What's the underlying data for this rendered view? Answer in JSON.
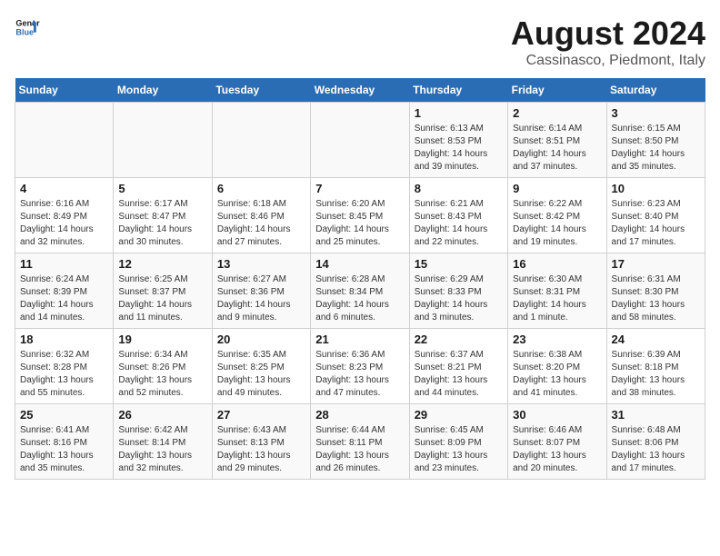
{
  "logo": {
    "line1": "General",
    "line2": "Blue"
  },
  "title": "August 2024",
  "subtitle": "Cassinasco, Piedmont, Italy",
  "days_header": [
    "Sunday",
    "Monday",
    "Tuesday",
    "Wednesday",
    "Thursday",
    "Friday",
    "Saturday"
  ],
  "weeks": [
    [
      {
        "day": "",
        "info": ""
      },
      {
        "day": "",
        "info": ""
      },
      {
        "day": "",
        "info": ""
      },
      {
        "day": "",
        "info": ""
      },
      {
        "day": "1",
        "info": "Sunrise: 6:13 AM\nSunset: 8:53 PM\nDaylight: 14 hours and 39 minutes."
      },
      {
        "day": "2",
        "info": "Sunrise: 6:14 AM\nSunset: 8:51 PM\nDaylight: 14 hours and 37 minutes."
      },
      {
        "day": "3",
        "info": "Sunrise: 6:15 AM\nSunset: 8:50 PM\nDaylight: 14 hours and 35 minutes."
      }
    ],
    [
      {
        "day": "4",
        "info": "Sunrise: 6:16 AM\nSunset: 8:49 PM\nDaylight: 14 hours and 32 minutes."
      },
      {
        "day": "5",
        "info": "Sunrise: 6:17 AM\nSunset: 8:47 PM\nDaylight: 14 hours and 30 minutes."
      },
      {
        "day": "6",
        "info": "Sunrise: 6:18 AM\nSunset: 8:46 PM\nDaylight: 14 hours and 27 minutes."
      },
      {
        "day": "7",
        "info": "Sunrise: 6:20 AM\nSunset: 8:45 PM\nDaylight: 14 hours and 25 minutes."
      },
      {
        "day": "8",
        "info": "Sunrise: 6:21 AM\nSunset: 8:43 PM\nDaylight: 14 hours and 22 minutes."
      },
      {
        "day": "9",
        "info": "Sunrise: 6:22 AM\nSunset: 8:42 PM\nDaylight: 14 hours and 19 minutes."
      },
      {
        "day": "10",
        "info": "Sunrise: 6:23 AM\nSunset: 8:40 PM\nDaylight: 14 hours and 17 minutes."
      }
    ],
    [
      {
        "day": "11",
        "info": "Sunrise: 6:24 AM\nSunset: 8:39 PM\nDaylight: 14 hours and 14 minutes."
      },
      {
        "day": "12",
        "info": "Sunrise: 6:25 AM\nSunset: 8:37 PM\nDaylight: 14 hours and 11 minutes."
      },
      {
        "day": "13",
        "info": "Sunrise: 6:27 AM\nSunset: 8:36 PM\nDaylight: 14 hours and 9 minutes."
      },
      {
        "day": "14",
        "info": "Sunrise: 6:28 AM\nSunset: 8:34 PM\nDaylight: 14 hours and 6 minutes."
      },
      {
        "day": "15",
        "info": "Sunrise: 6:29 AM\nSunset: 8:33 PM\nDaylight: 14 hours and 3 minutes."
      },
      {
        "day": "16",
        "info": "Sunrise: 6:30 AM\nSunset: 8:31 PM\nDaylight: 14 hours and 1 minute."
      },
      {
        "day": "17",
        "info": "Sunrise: 6:31 AM\nSunset: 8:30 PM\nDaylight: 13 hours and 58 minutes."
      }
    ],
    [
      {
        "day": "18",
        "info": "Sunrise: 6:32 AM\nSunset: 8:28 PM\nDaylight: 13 hours and 55 minutes."
      },
      {
        "day": "19",
        "info": "Sunrise: 6:34 AM\nSunset: 8:26 PM\nDaylight: 13 hours and 52 minutes."
      },
      {
        "day": "20",
        "info": "Sunrise: 6:35 AM\nSunset: 8:25 PM\nDaylight: 13 hours and 49 minutes."
      },
      {
        "day": "21",
        "info": "Sunrise: 6:36 AM\nSunset: 8:23 PM\nDaylight: 13 hours and 47 minutes."
      },
      {
        "day": "22",
        "info": "Sunrise: 6:37 AM\nSunset: 8:21 PM\nDaylight: 13 hours and 44 minutes."
      },
      {
        "day": "23",
        "info": "Sunrise: 6:38 AM\nSunset: 8:20 PM\nDaylight: 13 hours and 41 minutes."
      },
      {
        "day": "24",
        "info": "Sunrise: 6:39 AM\nSunset: 8:18 PM\nDaylight: 13 hours and 38 minutes."
      }
    ],
    [
      {
        "day": "25",
        "info": "Sunrise: 6:41 AM\nSunset: 8:16 PM\nDaylight: 13 hours and 35 minutes."
      },
      {
        "day": "26",
        "info": "Sunrise: 6:42 AM\nSunset: 8:14 PM\nDaylight: 13 hours and 32 minutes."
      },
      {
        "day": "27",
        "info": "Sunrise: 6:43 AM\nSunset: 8:13 PM\nDaylight: 13 hours and 29 minutes."
      },
      {
        "day": "28",
        "info": "Sunrise: 6:44 AM\nSunset: 8:11 PM\nDaylight: 13 hours and 26 minutes."
      },
      {
        "day": "29",
        "info": "Sunrise: 6:45 AM\nSunset: 8:09 PM\nDaylight: 13 hours and 23 minutes."
      },
      {
        "day": "30",
        "info": "Sunrise: 6:46 AM\nSunset: 8:07 PM\nDaylight: 13 hours and 20 minutes."
      },
      {
        "day": "31",
        "info": "Sunrise: 6:48 AM\nSunset: 8:06 PM\nDaylight: 13 hours and 17 minutes."
      }
    ]
  ]
}
